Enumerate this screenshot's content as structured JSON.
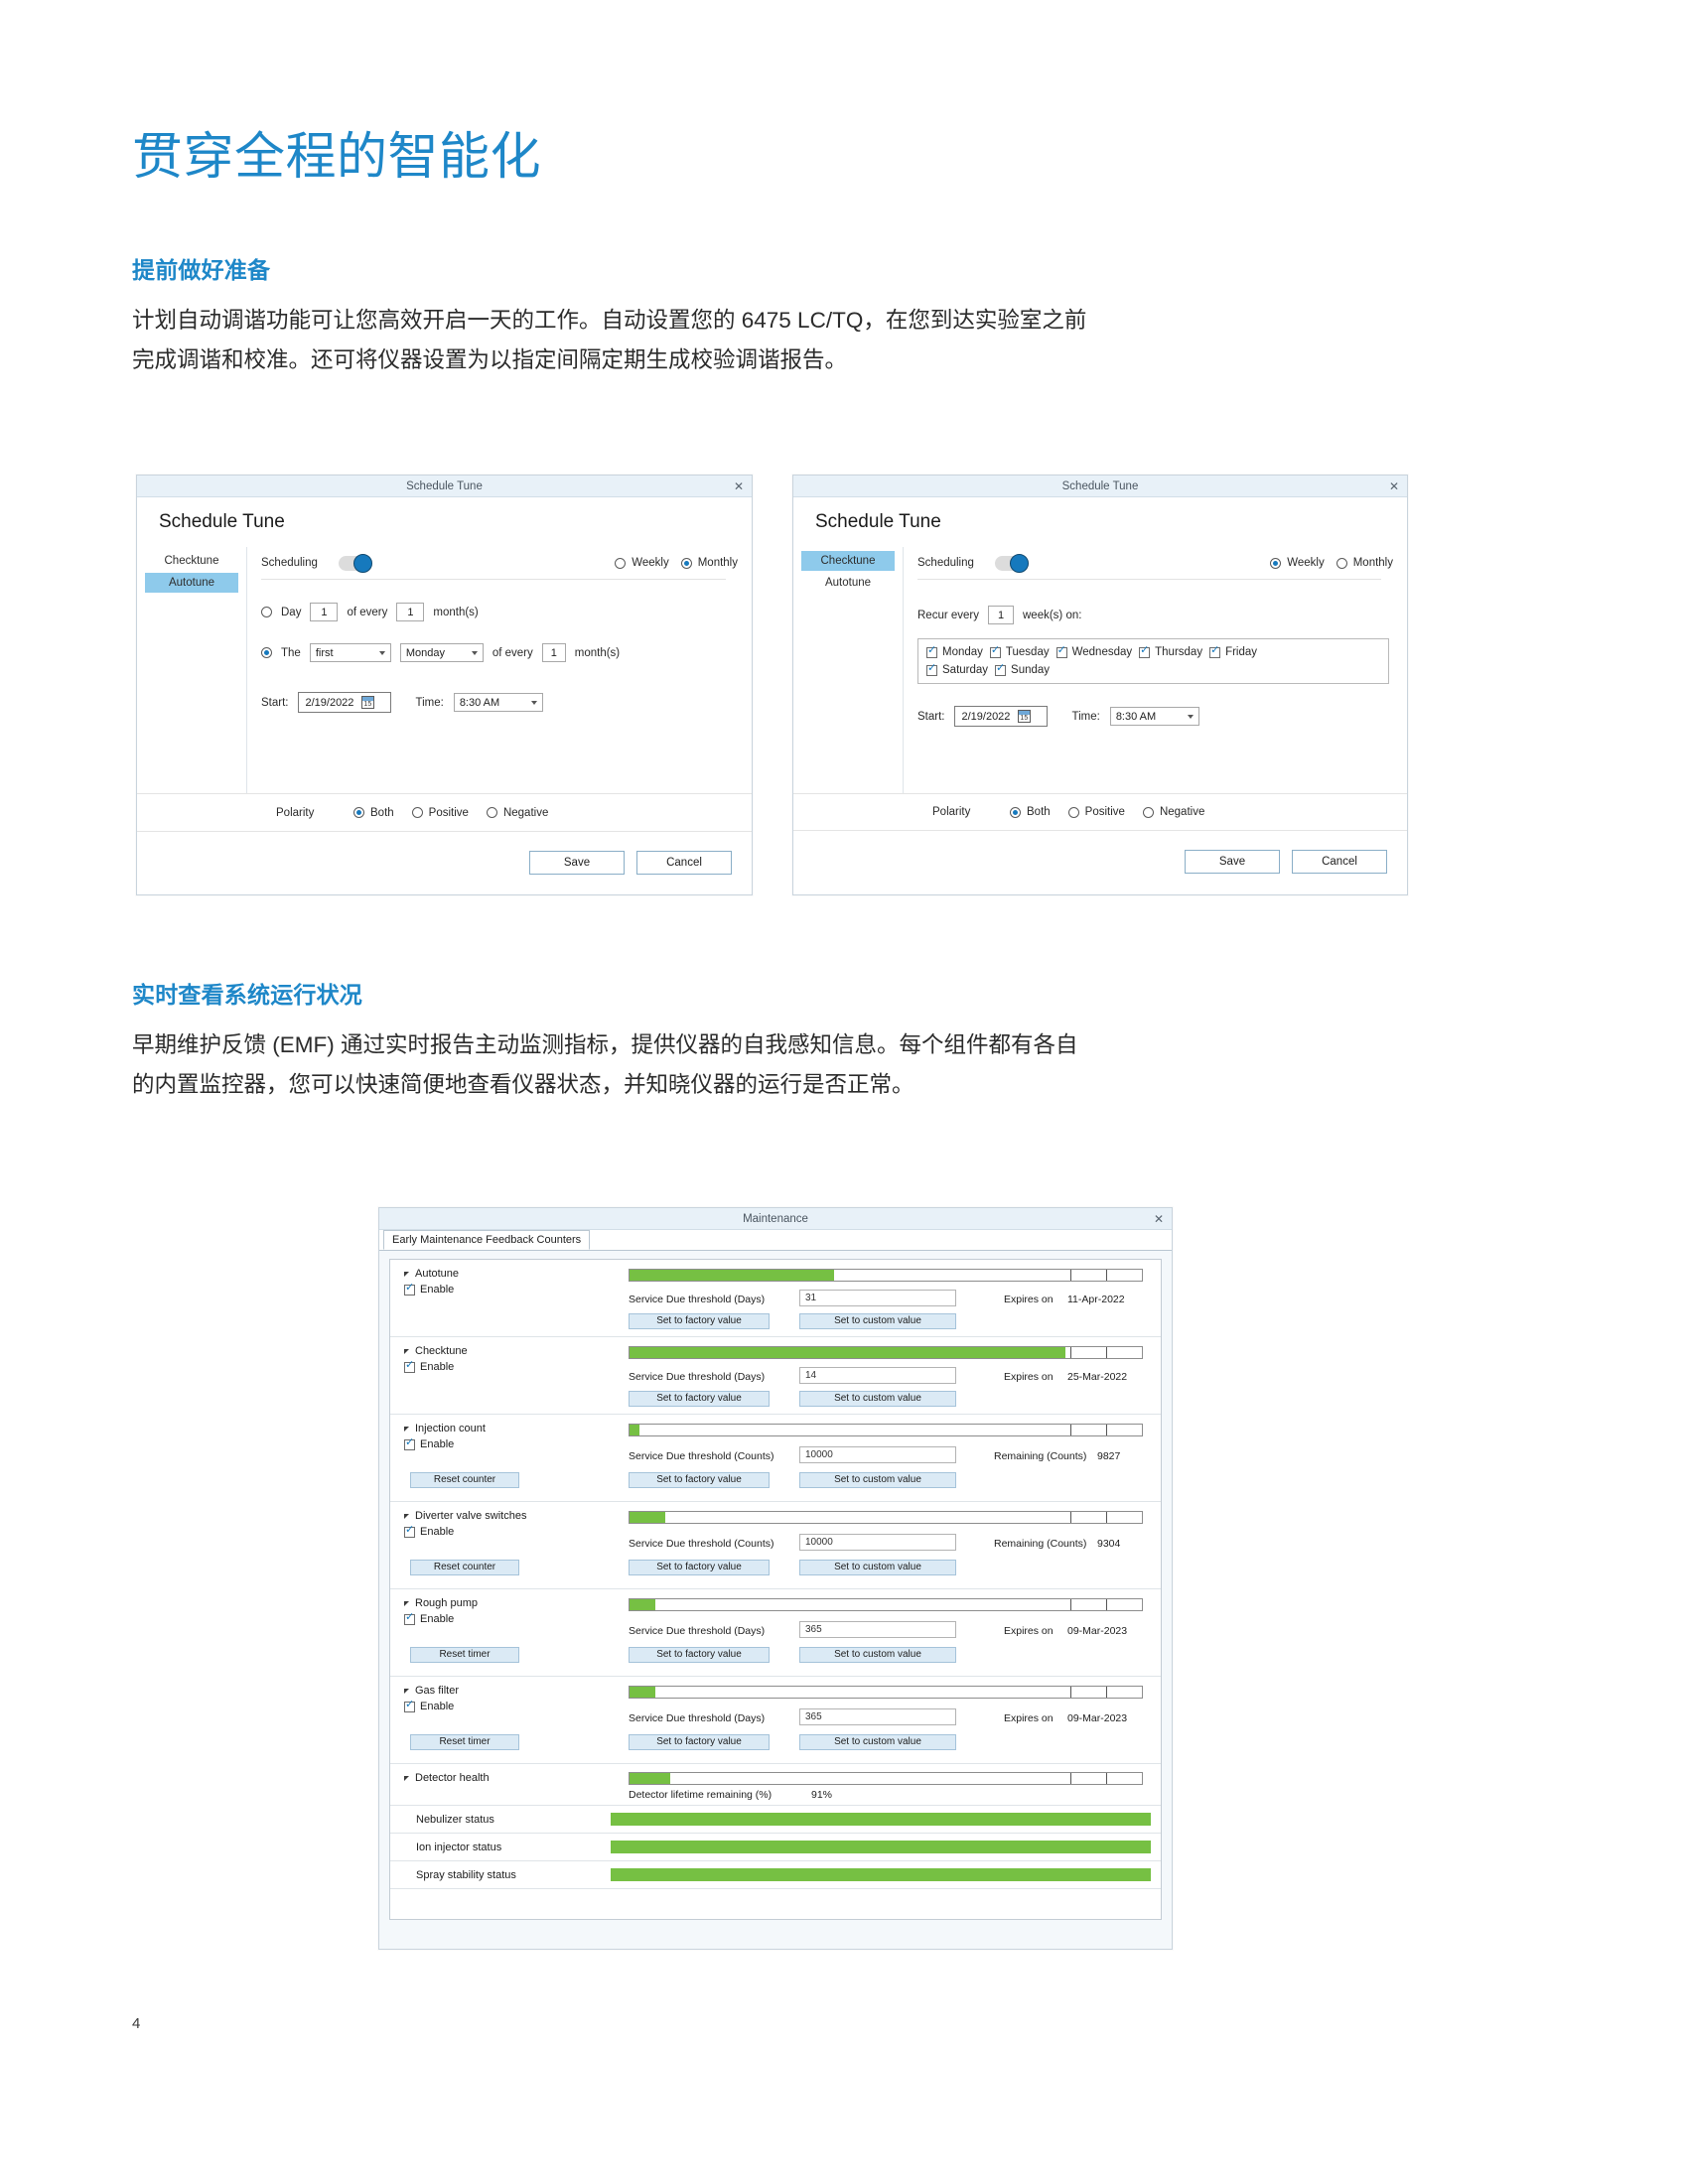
{
  "page": {
    "number": "4",
    "title": "贯穿全程的智能化",
    "sections": [
      {
        "heading": "提前做好准备",
        "body": "计划自动调谐功能可让您高效开启一天的工作。自动设置您的 6475 LC/TQ，在您到达实验室之前完成调谐和校准。还可将仪器设置为以指定间隔定期生成校验调谐报告。"
      },
      {
        "heading": "实时查看系统运行状况",
        "body": "早期维护反馈 (EMF) 通过实时报告主动监测指标，提供仪器的自我感知信息。每个组件都有各自的内置监控器，您可以快速简便地查看仪器状态，并知晓仪器的运行是否正常。"
      }
    ]
  },
  "colors": {
    "brand_blue": "#1e87c8",
    "accent_blue": "#1679bd",
    "nav_selected": "#8ecaeb",
    "bar_green": "#76c043",
    "title_bar": "#e8f1f8"
  },
  "schedule_tune_monthly": {
    "window_title": "Schedule Tune",
    "close_label": "✕",
    "heading": "Schedule Tune",
    "nav": [
      {
        "label": "Checktune",
        "selected": false
      },
      {
        "label": "Autotune",
        "selected": true
      }
    ],
    "scheduling_label": "Scheduling",
    "scheduling_on": true,
    "frequency": {
      "weekly_label": "Weekly",
      "monthly_label": "Monthly",
      "selected": "Monthly"
    },
    "day_rule": {
      "selected": false,
      "prefix": "Day",
      "day_value": "1",
      "middle": "of every",
      "interval_value": "1",
      "suffix": "month(s)"
    },
    "the_rule": {
      "selected": true,
      "prefix": "The",
      "ordinal_value": "first",
      "weekday_value": "Monday",
      "middle": "of every",
      "interval_value": "1",
      "suffix": "month(s)"
    },
    "start_label": "Start:",
    "start_value": "2/19/2022",
    "time_label": "Time:",
    "time_value": "8:30 AM",
    "polarity": {
      "label": "Polarity",
      "options": [
        "Both",
        "Positive",
        "Negative"
      ],
      "selected": "Both"
    },
    "save_label": "Save",
    "cancel_label": "Cancel"
  },
  "schedule_tune_weekly": {
    "window_title": "Schedule Tune",
    "close_label": "✕",
    "heading": "Schedule Tune",
    "nav": [
      {
        "label": "Checktune",
        "selected": true
      },
      {
        "label": "Autotune",
        "selected": false
      }
    ],
    "scheduling_label": "Scheduling",
    "scheduling_on": true,
    "frequency": {
      "weekly_label": "Weekly",
      "monthly_label": "Monthly",
      "selected": "Weekly"
    },
    "recur": {
      "prefix": "Recur every",
      "value": "1",
      "suffix": "week(s) on:"
    },
    "weekdays": [
      {
        "label": "Monday",
        "checked": true
      },
      {
        "label": "Tuesday",
        "checked": true
      },
      {
        "label": "Wednesday",
        "checked": true
      },
      {
        "label": "Thursday",
        "checked": true
      },
      {
        "label": "Friday",
        "checked": true
      },
      {
        "label": "Saturday",
        "checked": true
      },
      {
        "label": "Sunday",
        "checked": true
      }
    ],
    "start_label": "Start:",
    "start_value": "2/19/2022",
    "time_label": "Time:",
    "time_value": "8:30 AM",
    "polarity": {
      "label": "Polarity",
      "options": [
        "Both",
        "Positive",
        "Negative"
      ],
      "selected": "Both"
    },
    "save_label": "Save",
    "cancel_label": "Cancel"
  },
  "maintenance": {
    "window_title": "Maintenance",
    "close_label": "✕",
    "tab_label": "Early Maintenance Feedback Counters",
    "buttons": {
      "factory": "Set to factory value",
      "custom": "Set to custom value",
      "reset_counter": "Reset counter",
      "reset_timer": "Reset timer"
    },
    "enable_label": "Enable",
    "counters": [
      {
        "name": "Autotune",
        "enable": true,
        "bar_percent": 40,
        "threshold_label": "Service Due threshold (Days)",
        "threshold_value": "31",
        "status_label": "Expires on",
        "status_value": "11-Apr-2022",
        "reset_button": null
      },
      {
        "name": "Checktune",
        "enable": true,
        "bar_percent": 85,
        "threshold_label": "Service Due threshold (Days)",
        "threshold_value": "14",
        "status_label": "Expires on",
        "status_value": "25-Mar-2022",
        "reset_button": null
      },
      {
        "name": "Injection count",
        "enable": true,
        "bar_percent": 2,
        "threshold_label": "Service Due threshold (Counts)",
        "threshold_value": "10000",
        "status_label": "Remaining (Counts)",
        "status_value": "9827",
        "reset_button": "Reset counter"
      },
      {
        "name": "Diverter valve switches",
        "enable": true,
        "bar_percent": 7,
        "threshold_label": "Service Due threshold (Counts)",
        "threshold_value": "10000",
        "status_label": "Remaining (Counts)",
        "status_value": "9304",
        "reset_button": "Reset counter"
      },
      {
        "name": "Rough pump",
        "enable": true,
        "bar_percent": 5,
        "threshold_label": "Service Due threshold (Days)",
        "threshold_value": "365",
        "status_label": "Expires on",
        "status_value": "09-Mar-2023",
        "reset_button": "Reset timer"
      },
      {
        "name": "Gas filter",
        "enable": true,
        "bar_percent": 5,
        "threshold_label": "Service Due threshold (Days)",
        "threshold_value": "365",
        "status_label": "Expires on",
        "status_value": "09-Mar-2023",
        "reset_button": "Reset timer"
      }
    ],
    "detector_health": {
      "name": "Detector health",
      "bar_percent": 8,
      "label": "Detector lifetime remaining (%)",
      "value": "91%"
    },
    "statuses": [
      {
        "label": "Nebulizer status",
        "bar_percent": 100
      },
      {
        "label": "Ion injector status",
        "bar_percent": 100
      },
      {
        "label": "Spray stability status",
        "bar_percent": 100
      }
    ]
  }
}
